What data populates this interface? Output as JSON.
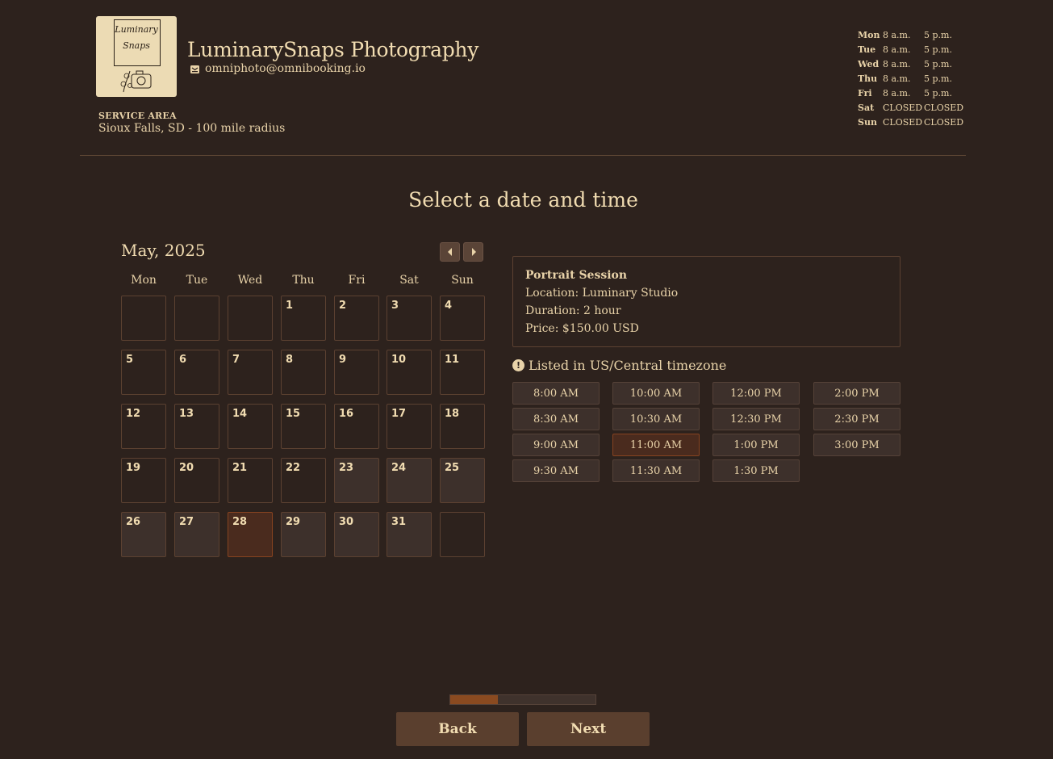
{
  "business": {
    "logo_text": [
      "Luminary",
      "Snaps"
    ],
    "name": "LuminarySnaps Photography",
    "email": "omniphoto@omnibooking.io",
    "service_area_label": "SERVICE AREA",
    "service_area": "Sioux Falls, SD - 100 mile radius"
  },
  "hours": [
    {
      "day": "Mon",
      "open": "8 a.m.",
      "close": "5 p.m."
    },
    {
      "day": "Tue",
      "open": "8 a.m.",
      "close": "5 p.m."
    },
    {
      "day": "Wed",
      "open": "8 a.m.",
      "close": "5 p.m."
    },
    {
      "day": "Thu",
      "open": "8 a.m.",
      "close": "5 p.m."
    },
    {
      "day": "Fri",
      "open": "8 a.m.",
      "close": "5 p.m."
    },
    {
      "day": "Sat",
      "open": "CLOSED",
      "close": "CLOSED"
    },
    {
      "day": "Sun",
      "open": "CLOSED",
      "close": "CLOSED"
    }
  ],
  "page": {
    "heading": "Select a date and time"
  },
  "calendar": {
    "month_label": "May, 2025",
    "weekdays": [
      "Mon",
      "Tue",
      "Wed",
      "Thu",
      "Fri",
      "Sat",
      "Sun"
    ],
    "weeks": [
      [
        "",
        "",
        "",
        "1",
        "2",
        "3",
        "4"
      ],
      [
        "5",
        "6",
        "7",
        "8",
        "9",
        "10",
        "11"
      ],
      [
        "12",
        "13",
        "14",
        "15",
        "16",
        "17",
        "18"
      ],
      [
        "19",
        "20",
        "21",
        "22",
        "23",
        "24",
        "25"
      ],
      [
        "26",
        "27",
        "28",
        "29",
        "30",
        "31",
        ""
      ]
    ],
    "available_days": [
      "23",
      "24",
      "25",
      "26",
      "27",
      "29",
      "30",
      "31"
    ],
    "selected_day": "28"
  },
  "service": {
    "title": "Portrait Session",
    "location": "Location: Luminary Studio",
    "duration": "Duration: 2 hour",
    "price": "Price: $150.00 USD"
  },
  "timezone_note": "Listed in US/Central timezone",
  "time_slots": [
    [
      "8:00 AM",
      "8:30 AM",
      "9:00 AM",
      "9:30 AM"
    ],
    [
      "10:00 AM",
      "10:30 AM",
      "11:00 AM",
      "11:30 AM"
    ],
    [
      "12:00 PM",
      "12:30 PM",
      "1:00 PM",
      "1:30 PM"
    ],
    [
      "2:00 PM",
      "2:30 PM",
      "3:00 PM"
    ]
  ],
  "selected_time": "11:00 AM",
  "progress_fraction": 0.33,
  "footer": {
    "back_label": "Back",
    "next_label": "Next"
  },
  "colors": {
    "background": "#2d221d",
    "text": "#e9d3a9",
    "accent": "#874320",
    "button": "#5a3f2e"
  }
}
